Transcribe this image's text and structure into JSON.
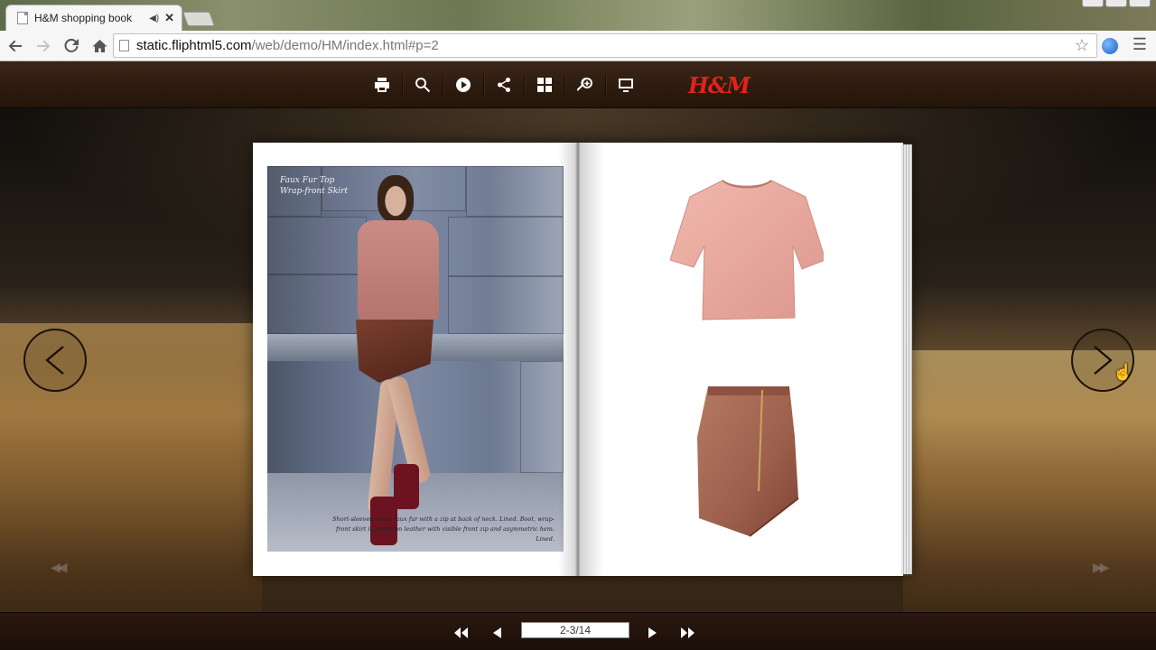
{
  "browser": {
    "tab_title": "H&M shopping book",
    "url_host": "static.fliphtml5.com",
    "url_path": "/web/demo/HM/index.html#p=2"
  },
  "viewer": {
    "logo_text": "H&M",
    "left_page": {
      "title": "Faux Fur Top\nWrap-front Skirt",
      "caption": "Short-sleeved top in faux fur with a zip at back of neck. Lined. Boot, wrap-front skirt in imitation leather with visible front zip and asymmetric hem. Lined."
    },
    "page_indicator": "2-3/14"
  },
  "colors": {
    "toolbar_bg": "#2f1d12",
    "logo_red": "#e2231a",
    "page_white": "#ffffff"
  },
  "icons": {
    "toolbar": [
      "print-icon",
      "search-icon",
      "play-icon",
      "share-icon",
      "thumbnails-icon",
      "zoom-in-icon",
      "fullscreen-icon"
    ],
    "navigation": [
      "first-page-icon",
      "previous-page-icon",
      "next-page-icon",
      "last-page-icon"
    ]
  }
}
